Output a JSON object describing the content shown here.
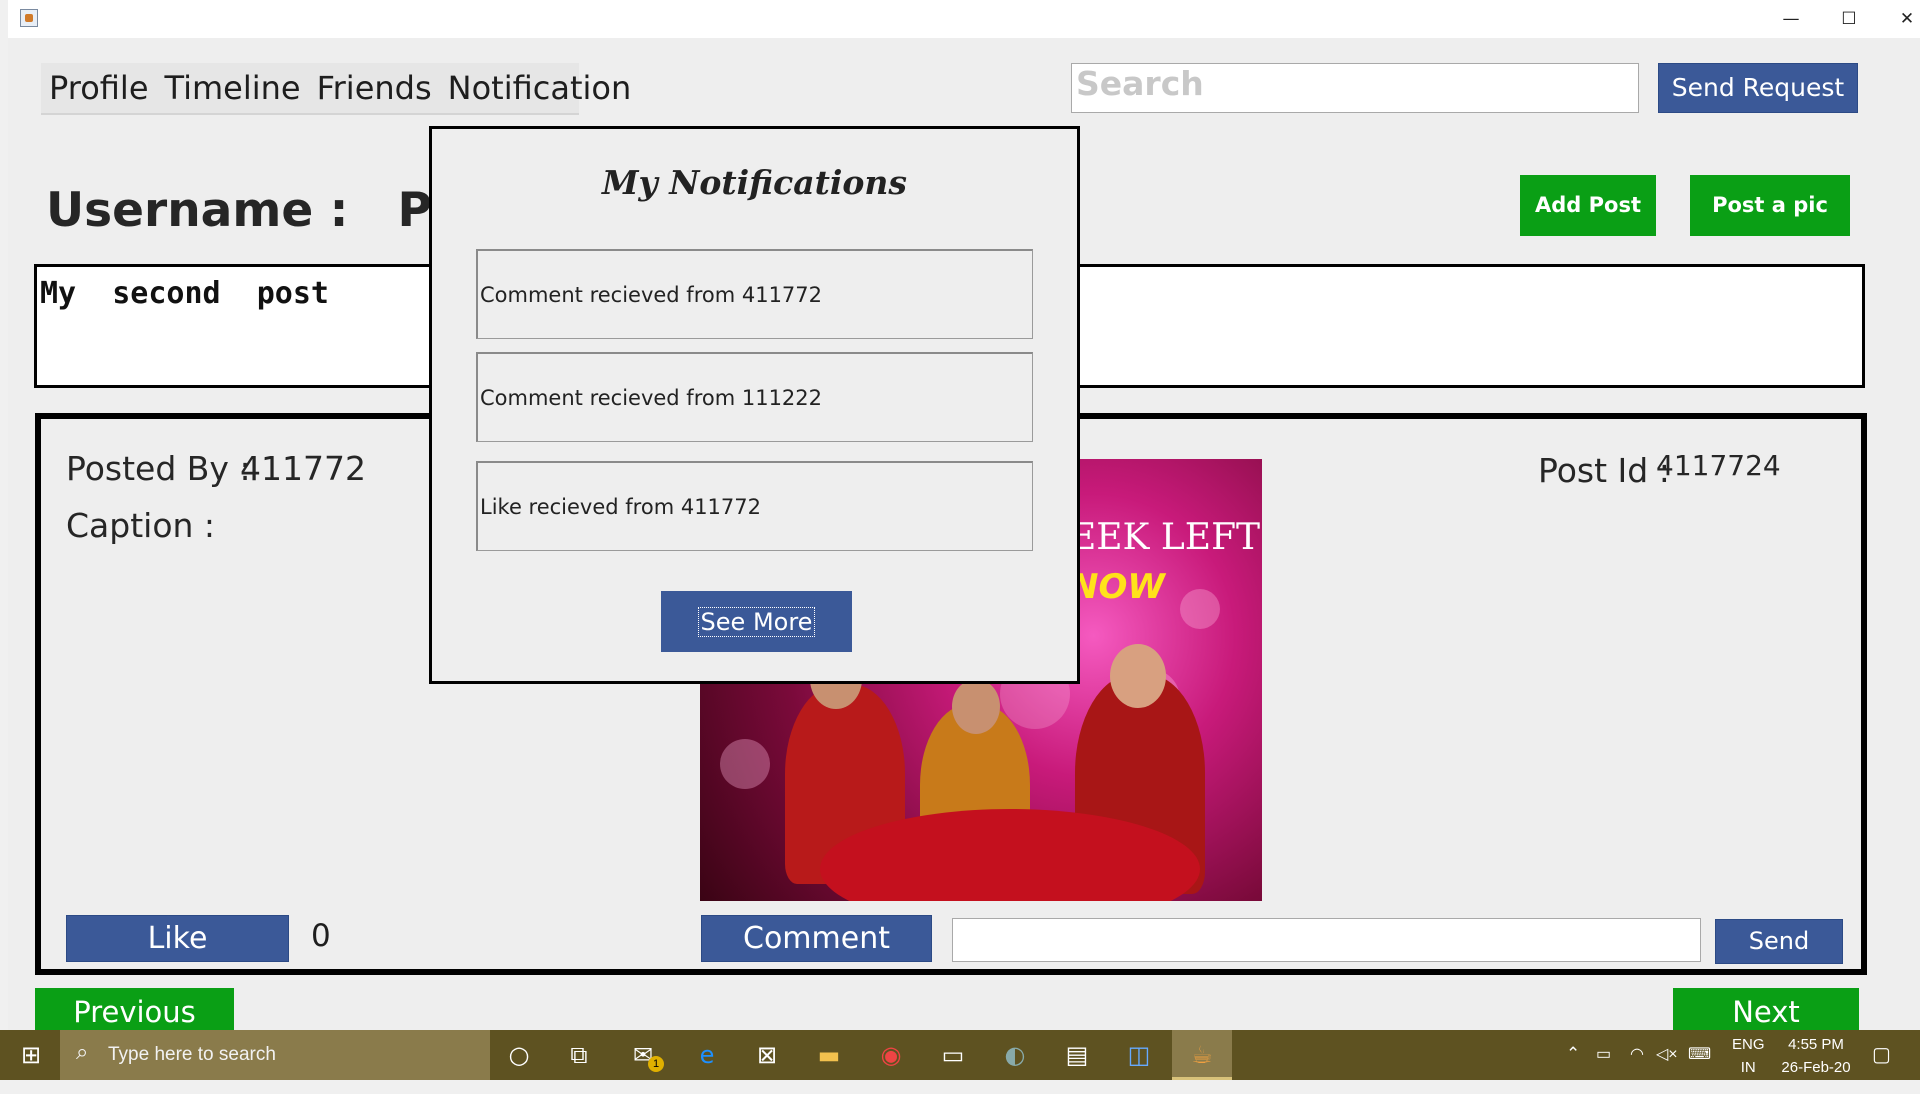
{
  "window": {
    "minimize_glyph": "—",
    "maximize_glyph": "☐",
    "close_glyph": "✕"
  },
  "menu": {
    "items": [
      {
        "label": "Profile"
      },
      {
        "label": "Timeline"
      },
      {
        "label": "Friends"
      },
      {
        "label": "Notification"
      }
    ]
  },
  "search": {
    "placeholder": "Search"
  },
  "send_request_label": "Send Request",
  "add_post_label": "Add Post",
  "post_pic_label": "Post a pic",
  "username_label": "Username :   Pava",
  "post_text": "My  second  post",
  "post": {
    "posted_by_label": "Posted By :",
    "posted_by_value": "411772",
    "caption_label": "Caption :",
    "post_id_label": "Post Id :",
    "post_id_value": "4117724",
    "image_text_1": "EEK LEFT",
    "image_text_2": "NOW",
    "like_label": "Like",
    "like_count": "0",
    "comment_label": "Comment",
    "send_label": "Send"
  },
  "nav": {
    "previous_label": "Previous",
    "next_label": "Next"
  },
  "popup": {
    "title": "My Notifications",
    "notifications": [
      {
        "text": "Comment recieved from 411772"
      },
      {
        "text": "Comment recieved from 111222"
      },
      {
        "text": "Like recieved from 411772"
      }
    ],
    "see_more_label": "See More"
  },
  "taskbar": {
    "search_placeholder": "Type here to search",
    "mail_badge": "1",
    "lang_top": "ENG",
    "lang_bottom": "IN",
    "time": "4:55 PM",
    "date": "26-Feb-20"
  },
  "colors": {
    "facebook_blue": "#3b5998",
    "green": "#0a9f15",
    "taskbar": "#5e5221"
  }
}
